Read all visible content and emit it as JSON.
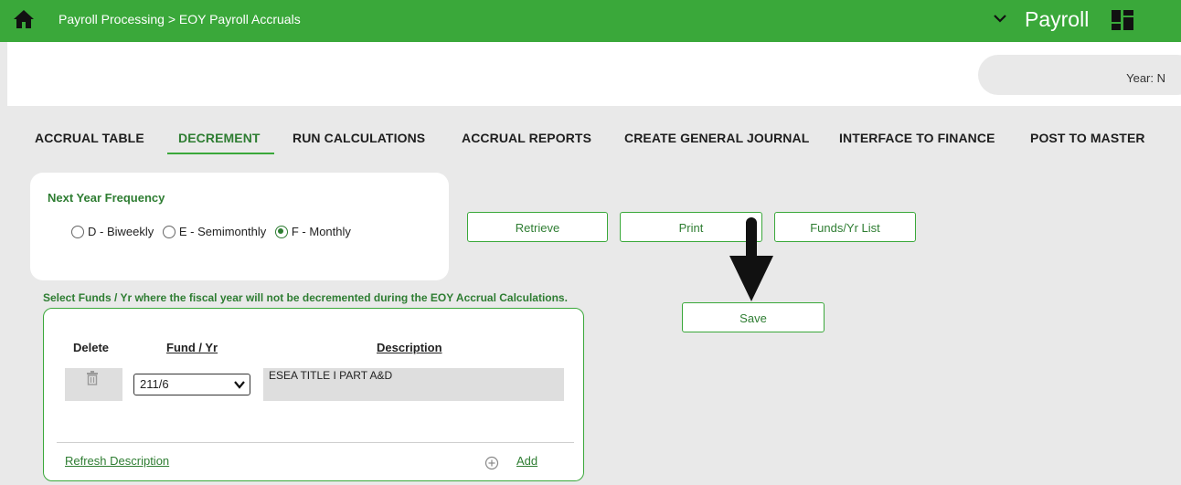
{
  "header": {
    "breadcrumb": "Payroll Processing > EOY Payroll Accruals",
    "app_title": "Payroll",
    "color": "#3aa83a"
  },
  "year": {
    "label": "Year: N"
  },
  "tabs": [
    {
      "label": "ACCRUAL TABLE"
    },
    {
      "label": "DECREMENT"
    },
    {
      "label": "RUN CALCULATIONS"
    },
    {
      "label": "ACCRUAL REPORTS"
    },
    {
      "label": "CREATE GENERAL JOURNAL"
    },
    {
      "label": "INTERFACE TO FINANCE"
    },
    {
      "label": "POST TO MASTER"
    }
  ],
  "frequency": {
    "title": "Next Year Frequency",
    "options": [
      {
        "label": "D - Biweekly",
        "selected": false
      },
      {
        "label": "E - Semimonthly",
        "selected": false
      },
      {
        "label": "F - Monthly",
        "selected": true
      }
    ]
  },
  "buttons": {
    "retrieve": "Retrieve",
    "print": "Print",
    "funds_list": "Funds/Yr List",
    "save": "Save"
  },
  "instruction": "Select Funds / Yr where the fiscal year will not be decremented during the EOY Accrual Calculations.",
  "table": {
    "headers": {
      "delete": "Delete",
      "fund_yr": "Fund / Yr",
      "description": "Description"
    },
    "rows": [
      {
        "fund_yr": "211/6",
        "description": "ESEA TITLE I PART A&D"
      }
    ]
  },
  "links": {
    "refresh": "Refresh Description",
    "add": "Add"
  }
}
